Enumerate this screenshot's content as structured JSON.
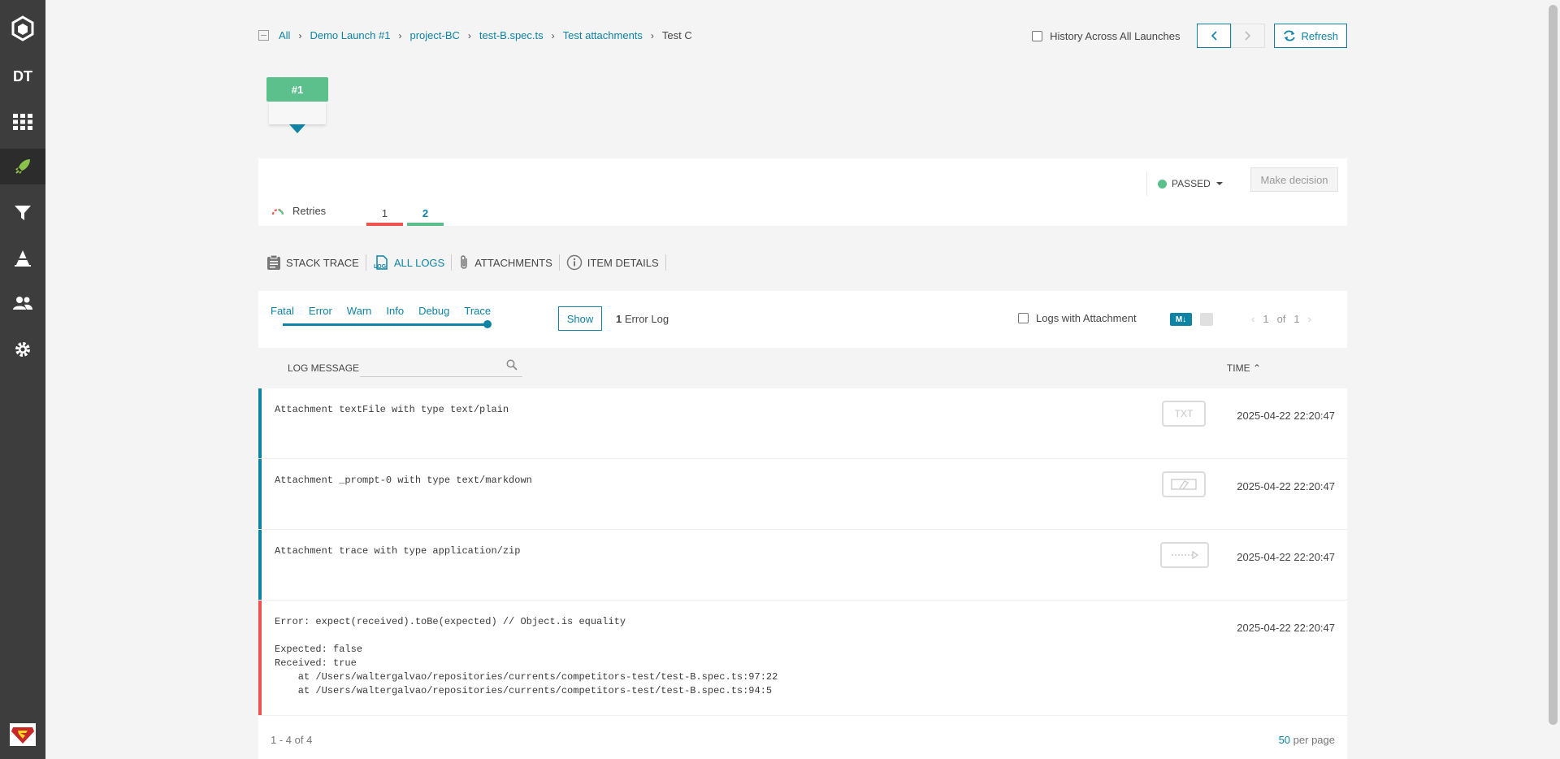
{
  "sidebar": {
    "logo_icon": "report-portal-logo",
    "project_initials": "DT",
    "items": [
      {
        "name": "dashboard-icon"
      },
      {
        "name": "launches-icon"
      },
      {
        "name": "filters-icon"
      },
      {
        "name": "debug-icon"
      },
      {
        "name": "members-icon"
      },
      {
        "name": "settings-icon"
      }
    ],
    "avatar": "user-avatar"
  },
  "breadcrumb": {
    "items": [
      "All",
      "Demo Launch #1",
      "project-BC",
      "test-B.spec.ts",
      "Test attachments"
    ],
    "current": "Test C"
  },
  "header": {
    "history_label": "History Across All Launches",
    "refresh_label": "Refresh"
  },
  "history_run": {
    "label": "#1",
    "color": "#5cc08d"
  },
  "status": {
    "label": "PASSED",
    "color": "#5cc08d",
    "decision_label": "Make decision"
  },
  "retries": {
    "label": "Retries",
    "items": [
      {
        "label": "1",
        "color": "#ef5350"
      },
      {
        "label": "2",
        "color": "#5cc08d",
        "active": true
      }
    ]
  },
  "item_tabs": [
    {
      "label": "STACK TRACE",
      "icon": "clipboard-icon"
    },
    {
      "label": "ALL LOGS",
      "icon": "logs-icon",
      "active": true
    },
    {
      "label": "ATTACHMENTS",
      "icon": "paperclip-icon"
    },
    {
      "label": "ITEM DETAILS",
      "icon": "info-icon"
    }
  ],
  "log_filter": {
    "levels": [
      "Fatal",
      "Error",
      "Warn",
      "Info",
      "Debug",
      "Trace"
    ],
    "selected_level": "Trace",
    "show_label": "Show",
    "error_count": "1",
    "error_label": "Error Log",
    "with_attachment_label": "Logs with Attachment",
    "markdown_label": "M↓",
    "page_current": "1",
    "page_of": "of",
    "page_total": "1"
  },
  "table": {
    "col_message": "LOG MESSAGE",
    "col_time": "TIME",
    "sort_indicator": "⌃",
    "rows": [
      {
        "message": "Attachment textFile with type text/plain",
        "time": "2025-04-22 22:20:47",
        "level": "info",
        "attachment": "TXT"
      },
      {
        "message": "Attachment _prompt-0 with type text/markdown",
        "time": "2025-04-22 22:20:47",
        "level": "info",
        "attachment": "md"
      },
      {
        "message": "Attachment trace with type application/zip",
        "time": "2025-04-22 22:20:47",
        "level": "info",
        "attachment": "zip"
      },
      {
        "message": "Error: expect(received).toBe(expected) // Object.is equality\n\nExpected: false\nReceived: true\n    at /Users/waltergalvao/repositories/currents/competitors-test/test-B.spec.ts:97:22\n    at /Users/waltergalvao/repositories/currents/competitors-test/test-B.spec.ts:94:5",
        "time": "2025-04-22 22:20:47",
        "level": "error"
      }
    ]
  },
  "footer": {
    "count": "1 - 4 of 4",
    "per_page_value": "50",
    "per_page_label": "per page"
  },
  "colors": {
    "accent": "#0f83a3",
    "passed": "#5cc08d",
    "failed": "#ef5350",
    "sidebar": "#3d3d3d"
  }
}
